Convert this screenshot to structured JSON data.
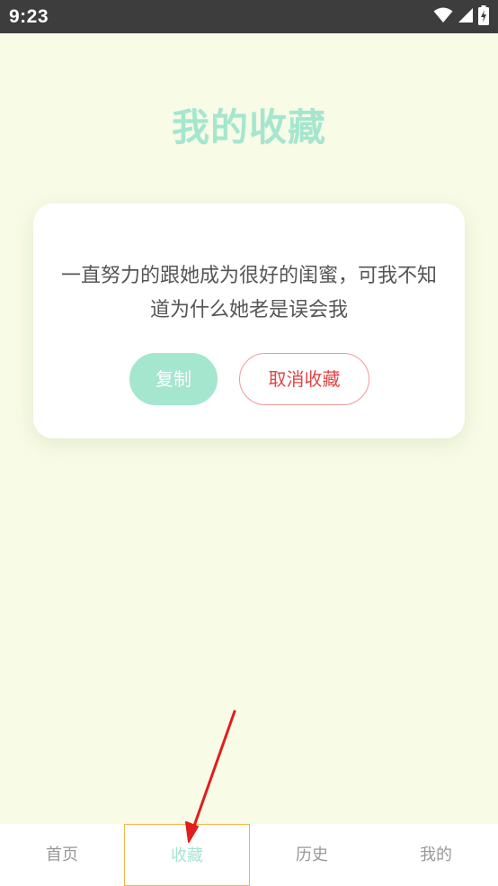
{
  "status_bar": {
    "time": "9:23",
    "icons": [
      "wifi-icon",
      "signal-icon",
      "battery-charging-icon"
    ]
  },
  "page": {
    "title": "我的收藏"
  },
  "favorite_card": {
    "text": "一直努力的跟她成为很好的闺蜜，可我不知道为什么她老是误会我",
    "copy_label": "复制",
    "uncollect_label": "取消收藏"
  },
  "tabbar": {
    "items": [
      {
        "label": "首页",
        "active": false
      },
      {
        "label": "收藏",
        "active": true
      },
      {
        "label": "历史",
        "active": false
      },
      {
        "label": "我的",
        "active": false
      }
    ]
  },
  "colors": {
    "background": "#f8fbe6",
    "accent": "#a5e6cf",
    "danger": "#e14444",
    "danger_border": "#ee9a9a",
    "highlight_border": "#f2b548",
    "annotation_arrow": "#e11d1d"
  },
  "annotation": {
    "icon": "red-arrow-annotation"
  }
}
